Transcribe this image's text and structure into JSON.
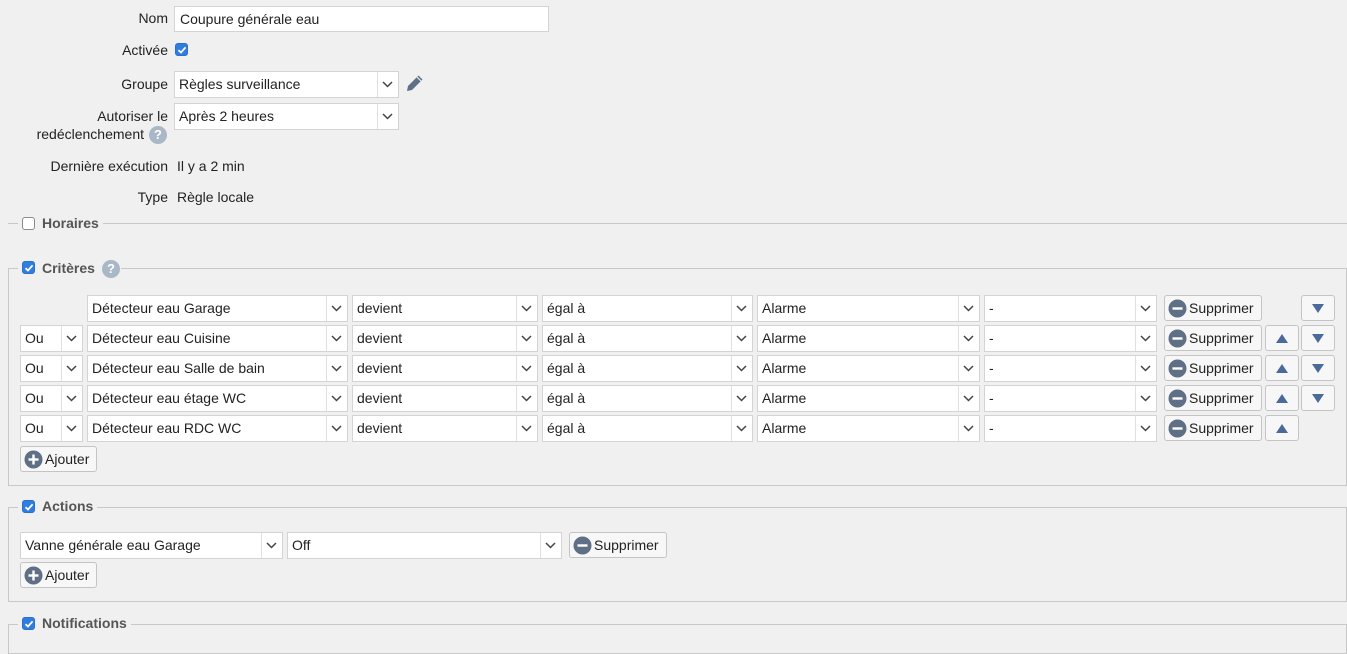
{
  "form": {
    "nom_label": "Nom",
    "nom_value": "Coupure générale eau",
    "activee_label": "Activée",
    "groupe_label": "Groupe",
    "groupe_value": "Règles surveillance",
    "redecl_label_1": "Autoriser le",
    "redecl_label_2": "redéclenchement",
    "redecl_value": "Après 2 heures",
    "derniere_label": "Dernière exécution",
    "derniere_value": "Il y a 2 min",
    "type_label": "Type",
    "type_value": "Règle locale"
  },
  "sections": {
    "horaires": "Horaires",
    "criteres": "Critères",
    "actions": "Actions",
    "notifications": "Notifications"
  },
  "criteria": [
    {
      "op": "",
      "device": "Détecteur eau Garage",
      "verb": "devient",
      "cmp": "égal à",
      "value": "Alarme",
      "extra": "-"
    },
    {
      "op": "Ou",
      "device": "Détecteur eau Cuisine",
      "verb": "devient",
      "cmp": "égal à",
      "value": "Alarme",
      "extra": "-"
    },
    {
      "op": "Ou",
      "device": "Détecteur eau Salle de bain",
      "verb": "devient",
      "cmp": "égal à",
      "value": "Alarme",
      "extra": "-"
    },
    {
      "op": "Ou",
      "device": "Détecteur eau étage WC",
      "verb": "devient",
      "cmp": "égal à",
      "value": "Alarme",
      "extra": "-"
    },
    {
      "op": "Ou",
      "device": "Détecteur eau RDC WC",
      "verb": "devient",
      "cmp": "égal à",
      "value": "Alarme",
      "extra": "-"
    }
  ],
  "action": {
    "device": "Vanne générale eau Garage",
    "state": "Off"
  },
  "buttons": {
    "supprimer": "Supprimer",
    "ajouter": "Ajouter"
  },
  "colors": {
    "checkbox": "#2f7de1",
    "button_icon": "#5f6f85"
  }
}
